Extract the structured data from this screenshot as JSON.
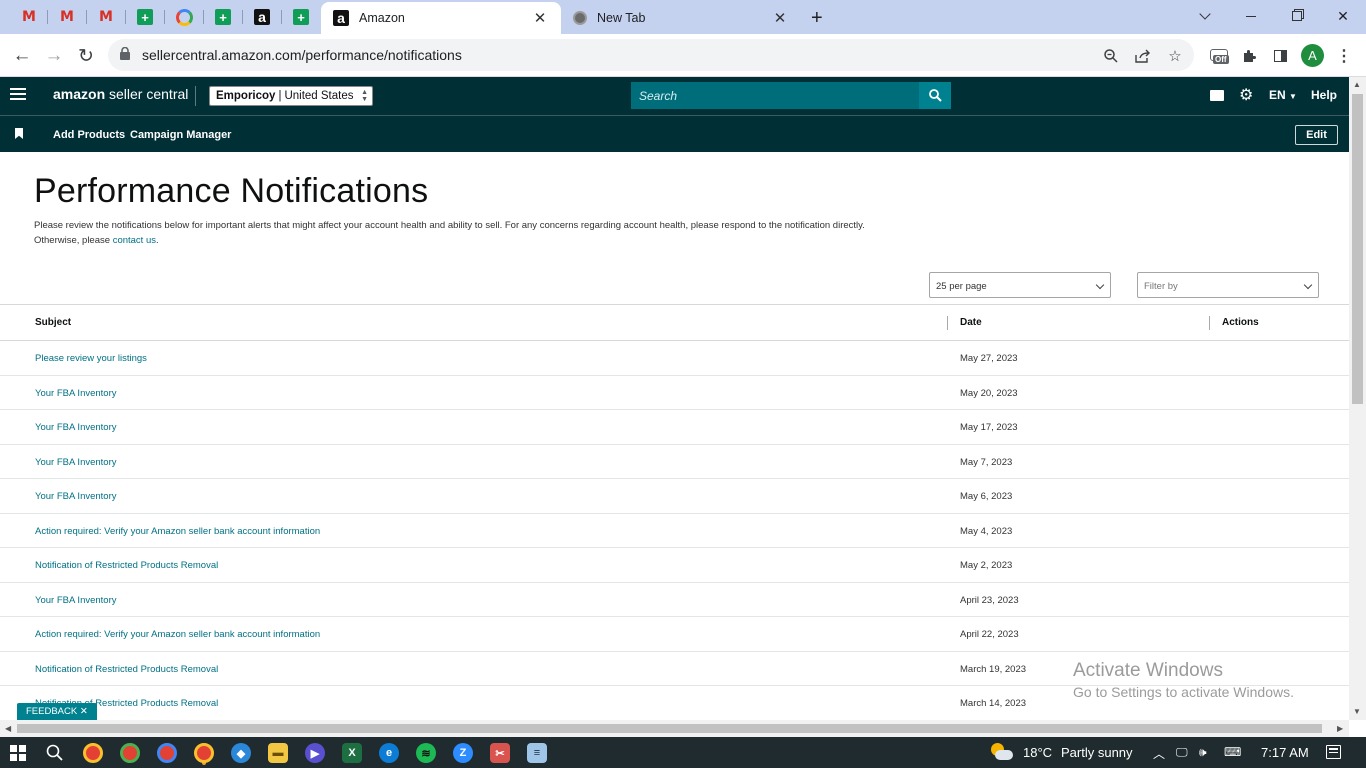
{
  "browser": {
    "tabs": [
      {
        "title": "Amazon"
      },
      {
        "title": "New Tab"
      }
    ],
    "url": "sellercentral.amazon.com/performance/notifications",
    "profile_initial": "A",
    "extension_badge": "Off"
  },
  "header": {
    "brand_bold": "amazon",
    "brand_rest": " seller central",
    "store_name": "Emporiсoy",
    "marketplace": "United States",
    "search_placeholder": "Search",
    "language": "EN",
    "help": "Help"
  },
  "subnav": {
    "links": [
      "Add Products",
      "Campaign Manager"
    ],
    "edit_label": "Edit"
  },
  "main": {
    "title": "Performance Notifications",
    "intro_text": "Please review the notifications below for important alerts that might affect your account health and ability to sell. For any concerns regarding account health, please respond to the notification directly. Otherwise, please ",
    "intro_link": "contact us",
    "intro_end": ".",
    "per_page": "25 per page",
    "filter_placeholder": "Filter by",
    "columns": [
      "Subject",
      "Date",
      "Actions"
    ],
    "rows": [
      {
        "subject": "Please review your listings",
        "date": "May 27, 2023"
      },
      {
        "subject": "Your FBA Inventory",
        "date": "May 20, 2023"
      },
      {
        "subject": "Your FBA Inventory",
        "date": "May 17, 2023"
      },
      {
        "subject": "Your FBA Inventory",
        "date": "May 7, 2023"
      },
      {
        "subject": "Your FBA Inventory",
        "date": "May 6, 2023"
      },
      {
        "subject": "Action required: Verify your Amazon seller bank account information",
        "date": "May 4, 2023"
      },
      {
        "subject": "Notification of Restricted Products Removal",
        "date": "May 2, 2023"
      },
      {
        "subject": "Your FBA Inventory",
        "date": "April 23, 2023"
      },
      {
        "subject": "Action required: Verify your Amazon seller bank account information",
        "date": "April 22, 2023"
      },
      {
        "subject": "Notification of Restricted Products Removal",
        "date": "March 19, 2023"
      },
      {
        "subject": "Notification of Restricted Products Removal",
        "date": "March 14, 2023"
      }
    ]
  },
  "feedback_label": "FEEDBACK",
  "watermark": {
    "line1": "Activate Windows",
    "line2": "Go to Settings to activate Windows."
  },
  "taskbar": {
    "weather_temp": "18°C",
    "weather_text": "Partly sunny",
    "time": "7:17 AM"
  },
  "colors": {
    "header_bg": "#002f36",
    "link": "#007185",
    "search_bg": "#006e7a",
    "accent": "#00818f"
  }
}
